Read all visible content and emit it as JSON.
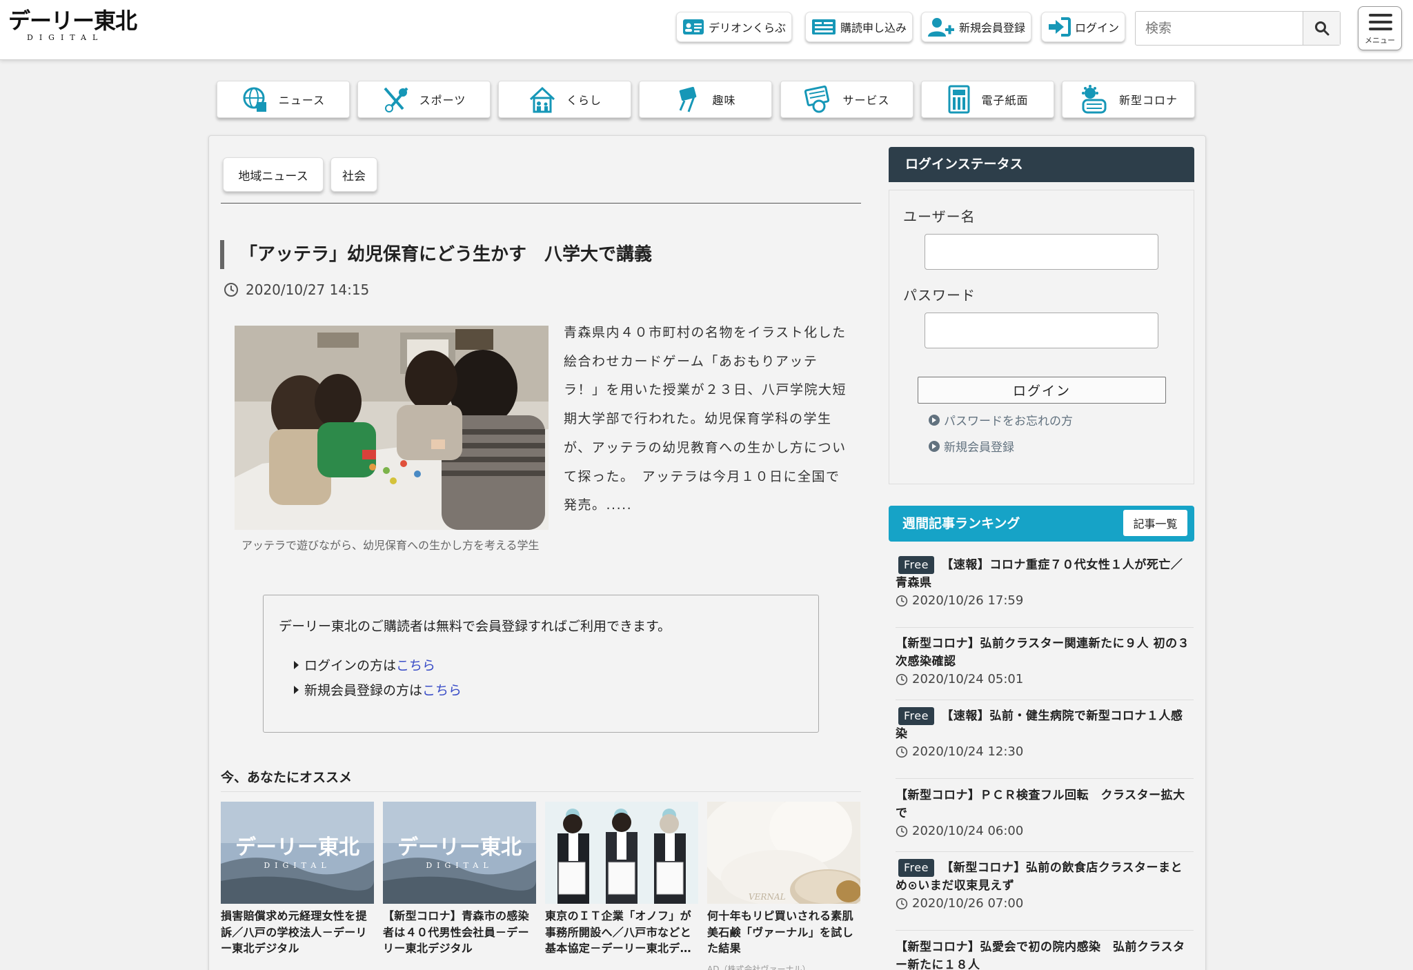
{
  "header": {
    "logo_main": "デーリー東北",
    "logo_sub": "DIGITAL",
    "buttons": [
      {
        "label": "デリオンくらぶ",
        "icon": "member-card-icon"
      },
      {
        "label": "購読申し込み",
        "icon": "newspaper-icon"
      },
      {
        "label": "新規会員登録",
        "icon": "add-user-icon"
      },
      {
        "label": "ログイン",
        "icon": "login-icon"
      }
    ],
    "search_placeholder": "検索",
    "menu_label": "メニュー"
  },
  "nav": {
    "categories": [
      {
        "label": "ニュース",
        "icon": "globe-news-icon"
      },
      {
        "label": "スポーツ",
        "icon": "sports-icon"
      },
      {
        "label": "くらし",
        "icon": "house-family-icon"
      },
      {
        "label": "趣味",
        "icon": "hobby-icon"
      },
      {
        "label": "サービス",
        "icon": "service-icon"
      },
      {
        "label": "電子紙面",
        "icon": "e-paper-icon"
      },
      {
        "label": "新型コロナ",
        "icon": "virus-mask-icon"
      }
    ]
  },
  "article": {
    "tags": [
      "地域ニュース",
      "社会"
    ],
    "title": "「アッテラ」幼児保育にどう生かす　八学大で講義",
    "date": "2020/10/27 14:15",
    "caption": "アッテラで遊びながら、幼児保育への生かし方を考える学生",
    "lead": "青森県内４０市町村の名物をイラスト化した絵合わせカードゲーム「あおもりアッテラ！」を用いた授業が２３日、八戸学院大短期大学部で行われた。幼児保育学科の学生が、アッテラの幼児教育への生かし方について探った。　アッテラは今月１０日に全国で発売。.....",
    "notice": {
      "text": "デーリー東北のご購読者は無料で会員登録すればご利用できます。",
      "login_prefix": "ログインの方は",
      "register_prefix": "新規会員登録の方は",
      "link_text": "こちら"
    }
  },
  "recommend": {
    "heading": "今、あなたにオススメ",
    "cards": [
      {
        "title": "損害賠償求め元経理女性を提訴／八戸の学校法人－デーリー東北デジタル",
        "image_text": "デーリー東北",
        "image_sub": "DIGITAL"
      },
      {
        "title": "【新型コロナ】青森市の感染者は４０代男性会社員－デーリー東北デジタル",
        "image_text": "デーリー東北",
        "image_sub": "DIGITAL"
      },
      {
        "title": "東京のＩＴ企業「オノフ」が事務所開設へ／八戸市などと基本協定－デーリー東北デ…",
        "image_text": "",
        "image_sub": ""
      },
      {
        "title": "何十年もリピ買いされる素肌美石鹸「ヴァーナル」を試した結果",
        "image_text": "VERNAL",
        "image_sub": ""
      }
    ],
    "ad_label": "AD（株式会社ヴァーナル）"
  },
  "sidebar": {
    "login": {
      "heading": "ログインステータス",
      "username_label": "ユーザー名",
      "password_label": "パスワード",
      "button": "ログイン",
      "forgot_link": "パスワードをお忘れの方",
      "register_link": "新規会員登録"
    },
    "ranking": {
      "heading": "週間記事ランキング",
      "all_button": "記事一覧",
      "free_label": "Free",
      "items": [
        {
          "free": true,
          "title": "【速報】コロナ重症７０代女性１人が死亡／青森県",
          "date": "2020/10/26 17:59"
        },
        {
          "free": false,
          "title": "【新型コロナ】弘前クラスター関連新たに９人 初の３次感染確認",
          "date": "2020/10/24 05:01"
        },
        {
          "free": true,
          "title": "【速報】弘前・健生病院で新型コロナ１人感染",
          "date": "2020/10/24 12:30"
        },
        {
          "free": false,
          "title": "【新型コロナ】ＰＣＲ検査フル回転　クラスター拡大で",
          "date": "2020/10/24 06:00"
        },
        {
          "free": true,
          "title": "【新型コロナ】弘前の飲食店クラスターまとめ⊙いまだ収束見えず",
          "date": "2020/10/26 07:00"
        },
        {
          "free": false,
          "title": "【新型コロナ】弘愛会で初の院内感染　弘前クラスター新たに１８人",
          "date": ""
        }
      ]
    }
  },
  "colors": {
    "accent": "#16a3c7",
    "dark_head": "#2d3e4a",
    "link": "#3a4dc7",
    "icon_teal": "#1697b7"
  }
}
